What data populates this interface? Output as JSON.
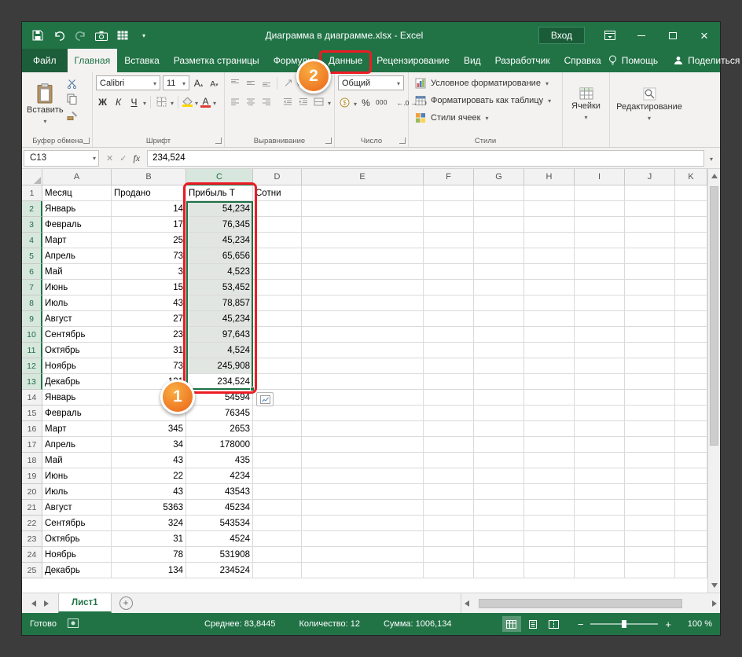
{
  "window": {
    "title": "Диаграмма в диаграмме.xlsx  -  Excel",
    "signin": "Вход"
  },
  "tabs": [
    {
      "id": "file",
      "label": "Файл",
      "file": true
    },
    {
      "id": "home",
      "label": "Главная",
      "active": true
    },
    {
      "id": "insert",
      "label": "Вставка"
    },
    {
      "id": "page-layout",
      "label": "Разметка страницы"
    },
    {
      "id": "formulas",
      "label": "Формулы"
    },
    {
      "id": "data",
      "label": "Данные",
      "annotated": true
    },
    {
      "id": "review",
      "label": "Рецензирование"
    },
    {
      "id": "view",
      "label": "Вид"
    },
    {
      "id": "developer",
      "label": "Разработчик"
    },
    {
      "id": "help",
      "label": "Справка"
    }
  ],
  "tab_extras": {
    "assistant": "Помощь",
    "share": "Поделиться"
  },
  "ribbon": {
    "clipboard": {
      "paste": "Вставить",
      "label": "Буфер обмена"
    },
    "font": {
      "name": "Calibri",
      "size": "11",
      "bold": "Ж",
      "italic": "К",
      "underline": "Ч",
      "label": "Шрифт"
    },
    "alignment": {
      "label": "Выравнивание"
    },
    "number": {
      "format": "Общий",
      "label": "Число"
    },
    "styles": {
      "items": [
        "Условное форматирование",
        "Форматировать как таблицу",
        "Стили ячеек"
      ],
      "label": "Стили"
    },
    "cells": {
      "label": "Ячейки"
    },
    "editing": {
      "label": "Редактирование"
    }
  },
  "formula_bar": {
    "name_box": "C13",
    "fx": "fx",
    "value": "234,524"
  },
  "grid": {
    "columns": [
      "A",
      "B",
      "C",
      "D",
      "E",
      "F",
      "G",
      "H",
      "I",
      "J",
      "K"
    ],
    "selection": {
      "range": "C2:C13",
      "active_cell": "C13",
      "column": "C",
      "rows_from": 2,
      "rows_to": 13
    },
    "rows": [
      {
        "n": 1,
        "a": "Месяц",
        "b": "Продано",
        "c": "Прибыль Т",
        "d": "Сотни"
      },
      {
        "n": 2,
        "a": "Январь",
        "b": "14",
        "c": "54,234"
      },
      {
        "n": 3,
        "a": "Февраль",
        "b": "17",
        "c": "76,345"
      },
      {
        "n": 4,
        "a": "Март",
        "b": "25",
        "c": "45,234"
      },
      {
        "n": 5,
        "a": "Апрель",
        "b": "73",
        "c": "65,656"
      },
      {
        "n": 6,
        "a": "Май",
        "b": "3",
        "c": "4,523"
      },
      {
        "n": 7,
        "a": "Июнь",
        "b": "15",
        "c": "53,452"
      },
      {
        "n": 8,
        "a": "Июль",
        "b": "43",
        "c": "78,857"
      },
      {
        "n": 9,
        "a": "Август",
        "b": "27",
        "c": "45,234"
      },
      {
        "n": 10,
        "a": "Сентябрь",
        "b": "23",
        "c": "97,643"
      },
      {
        "n": 11,
        "a": "Октябрь",
        "b": "31",
        "c": "4,524"
      },
      {
        "n": 12,
        "a": "Ноябрь",
        "b": "73",
        "c": "245,908"
      },
      {
        "n": 13,
        "a": "Декабрь",
        "b": "131",
        "c": "234,524"
      },
      {
        "n": 14,
        "a": "Январь",
        "b": "",
        "c": "54594"
      },
      {
        "n": 15,
        "a": "Февраль",
        "b": "",
        "c": "76345"
      },
      {
        "n": 16,
        "a": "Март",
        "b": "345",
        "c": "2653"
      },
      {
        "n": 17,
        "a": "Апрель",
        "b": "34",
        "c": "178000"
      },
      {
        "n": 18,
        "a": "Май",
        "b": "43",
        "c": "435"
      },
      {
        "n": 19,
        "a": "Июнь",
        "b": "22",
        "c": "4234"
      },
      {
        "n": 20,
        "a": "Июль",
        "b": "43",
        "c": "43543"
      },
      {
        "n": 21,
        "a": "Август",
        "b": "5363",
        "c": "45234"
      },
      {
        "n": 22,
        "a": "Сентябрь",
        "b": "324",
        "c": "543534"
      },
      {
        "n": 23,
        "a": "Октябрь",
        "b": "31",
        "c": "4524"
      },
      {
        "n": 24,
        "a": "Ноябрь",
        "b": "78",
        "c": "531908"
      },
      {
        "n": 25,
        "a": "Декабрь",
        "b": "134",
        "c": "234524"
      }
    ]
  },
  "annotations": {
    "step1": "1",
    "step2": "2"
  },
  "sheet_bar": {
    "active_tab": "Лист1"
  },
  "status_bar": {
    "mode": "Готово",
    "average": "Среднее: 83,8445",
    "count": "Количество: 12",
    "sum": "Сумма: 1006,134",
    "zoom_level": "100 %"
  }
}
